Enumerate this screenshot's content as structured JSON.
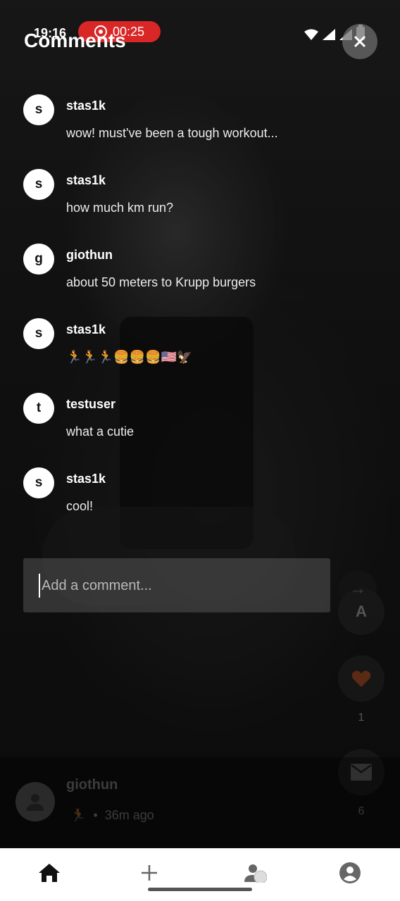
{
  "status_bar": {
    "time": "19:16",
    "recording_time": "00:25"
  },
  "header": {
    "title": "Comments"
  },
  "comments": [
    {
      "initial": "s",
      "user": "stas1k",
      "text": "wow! must've been a tough workout..."
    },
    {
      "initial": "s",
      "user": "stas1k",
      "text": "how much km run?"
    },
    {
      "initial": "g",
      "user": "giothun",
      "text": "about 50 meters to Krupp burgers"
    },
    {
      "initial": "s",
      "user": "stas1k",
      "text": "🏃🏃🏃🍔🍔🍔🇺🇸🦅"
    },
    {
      "initial": "t",
      "user": "testuser",
      "text": "what a cutie"
    },
    {
      "initial": "s",
      "user": "stas1k",
      "text": "cool!"
    }
  ],
  "input": {
    "placeholder": "Add a comment...",
    "value": ""
  },
  "send_button": {
    "label": "→"
  },
  "side_actions": {
    "author_initial": "A",
    "likes_count": "1",
    "messages_count": "6"
  },
  "post": {
    "user": "giothun",
    "activity_emoji": "🏃",
    "time_ago": "36m ago"
  },
  "icons": {
    "close": "close-icon",
    "send": "arrow-right-icon",
    "home": "home-icon",
    "add": "plus-icon",
    "friends": "people-icon",
    "profile": "account-circle-icon"
  }
}
